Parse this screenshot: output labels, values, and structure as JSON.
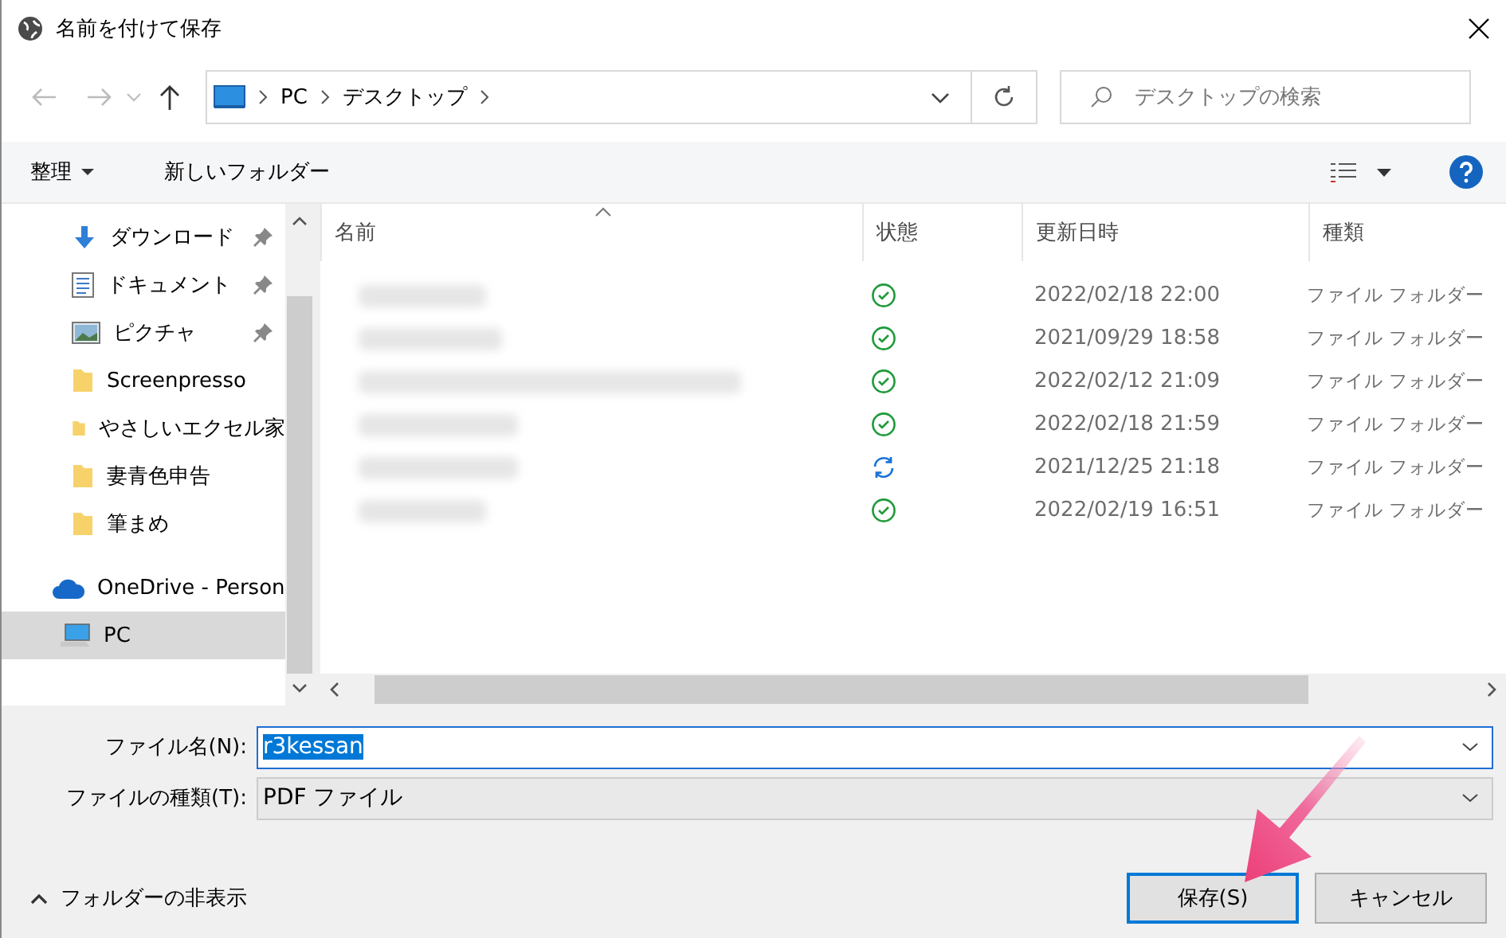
{
  "window": {
    "title": "名前を付けて保存"
  },
  "address_bar": {
    "crumbs": [
      "PC",
      "デスクトップ"
    ]
  },
  "search": {
    "placeholder": "デスクトップの検索"
  },
  "toolbar": {
    "organize": "整理",
    "new_folder": "新しいフォルダー"
  },
  "sidebar": {
    "items": [
      {
        "kind": "download",
        "label": "ダウンロード",
        "pinned": true,
        "selected": false
      },
      {
        "kind": "document",
        "label": "ドキュメント",
        "pinned": true,
        "selected": false
      },
      {
        "kind": "picture",
        "label": "ピクチャ",
        "pinned": true,
        "selected": false
      },
      {
        "kind": "folder",
        "label": "Screenpresso",
        "pinned": false,
        "selected": false
      },
      {
        "kind": "folder",
        "label": "やさしいエクセル家",
        "pinned": false,
        "selected": false
      },
      {
        "kind": "folder",
        "label": "妻青色申告",
        "pinned": false,
        "selected": false
      },
      {
        "kind": "folder",
        "label": "筆まめ",
        "pinned": false,
        "selected": false
      },
      {
        "kind": "cloud",
        "label": "OneDrive - Person",
        "pinned": false,
        "selected": false
      },
      {
        "kind": "pc",
        "label": "PC",
        "pinned": false,
        "selected": true
      }
    ]
  },
  "table": {
    "columns": [
      "名前",
      "状態",
      "更新日時",
      "種類"
    ],
    "rows": [
      {
        "kind": "synced",
        "modified": "2022/02/18 22:00",
        "type": "ファイル フォルダー"
      },
      {
        "kind": "synced",
        "modified": "2021/09/29 18:58",
        "type": "ファイル フォルダー"
      },
      {
        "kind": "synced",
        "modified": "2022/02/12 21:09",
        "type": "ファイル フォルダー"
      },
      {
        "kind": "synced",
        "modified": "2022/02/18 21:59",
        "type": "ファイル フォルダー"
      },
      {
        "kind": "syncing",
        "modified": "2021/12/25 21:18",
        "type": "ファイル フォルダー"
      },
      {
        "kind": "synced",
        "modified": "2022/02/19 16:51",
        "type": "ファイル フォルダー"
      }
    ]
  },
  "form": {
    "filename_label": "ファイル名(N):",
    "filename": "r3kessan",
    "filename_selected": true,
    "filetype_label": "ファイルの種類(T):",
    "filetype": "PDF ファイル"
  },
  "footer": {
    "hide_folders": "フォルダーの非表示",
    "save": "保存(S)",
    "cancel": "キャンセル"
  }
}
